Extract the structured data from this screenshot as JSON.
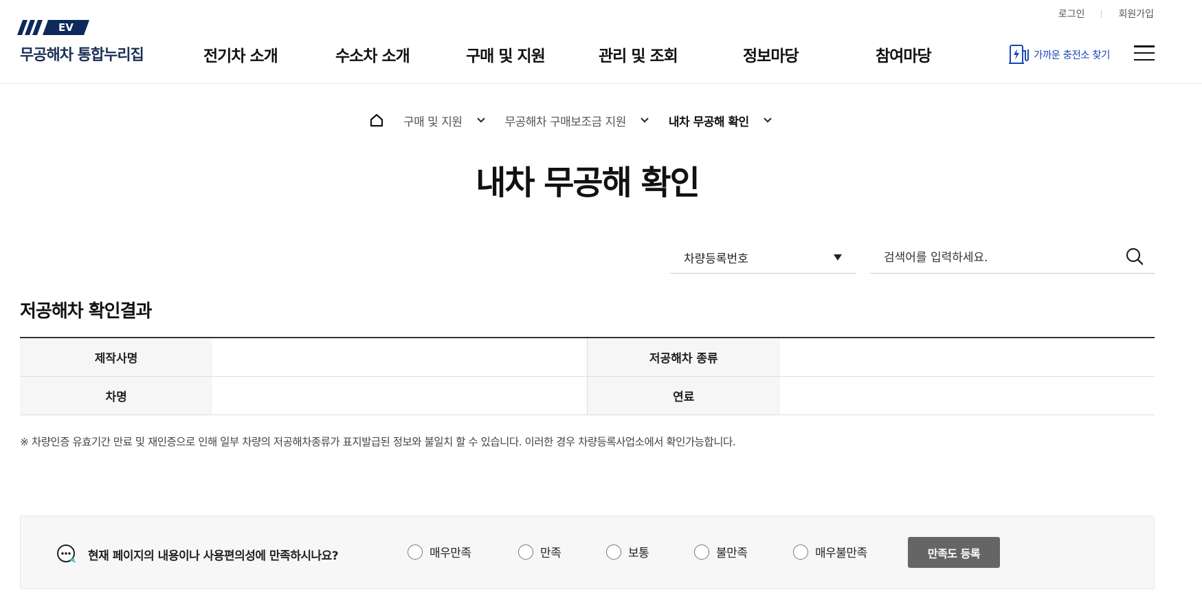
{
  "header": {
    "logo_badge": "EV",
    "logo_text": "무공해차 통합누리집",
    "util": {
      "login": "로그인",
      "signup": "회원가입"
    },
    "nav": [
      "전기차 소개",
      "수소차 소개",
      "구매 및 지원",
      "관리 및 조회",
      "정보마당",
      "참여마당"
    ],
    "charge_link": "가까운 충전소 찾기"
  },
  "breadcrumb": {
    "items": [
      "구매 및 지원",
      "무공해차 구매보조금 지원",
      "내차 무공해 확인"
    ]
  },
  "page_title": "내차 무공해 확인",
  "search": {
    "select_value": "차량등록번호",
    "placeholder": "검색어를 입력하세요."
  },
  "result": {
    "title": "저공해차 확인결과",
    "rows": [
      {
        "label1": "제작사명",
        "value1": "",
        "label2": "저공해차 종류",
        "value2": ""
      },
      {
        "label1": "차명",
        "value1": "",
        "label2": "연료",
        "value2": ""
      }
    ],
    "notice": "※ 차량인증 유효기간 만료 및 재인증으로 인해 일부 차량의 저공해차종류가 표지발급된 정보와 불일치 할 수 있습니다. 이러한 경우 차량등록사업소에서 확인가능합니다."
  },
  "survey": {
    "question": "현재 페이지의 내용이나 사용편의성에 만족하시나요?",
    "options": [
      "매우만족",
      "만족",
      "보통",
      "불만족",
      "매우불만족"
    ],
    "submit": "만족도 등록"
  },
  "colors": {
    "brand_navy": "#0d2a5a",
    "link_blue": "#1745b8",
    "button_gray": "#656565"
  }
}
